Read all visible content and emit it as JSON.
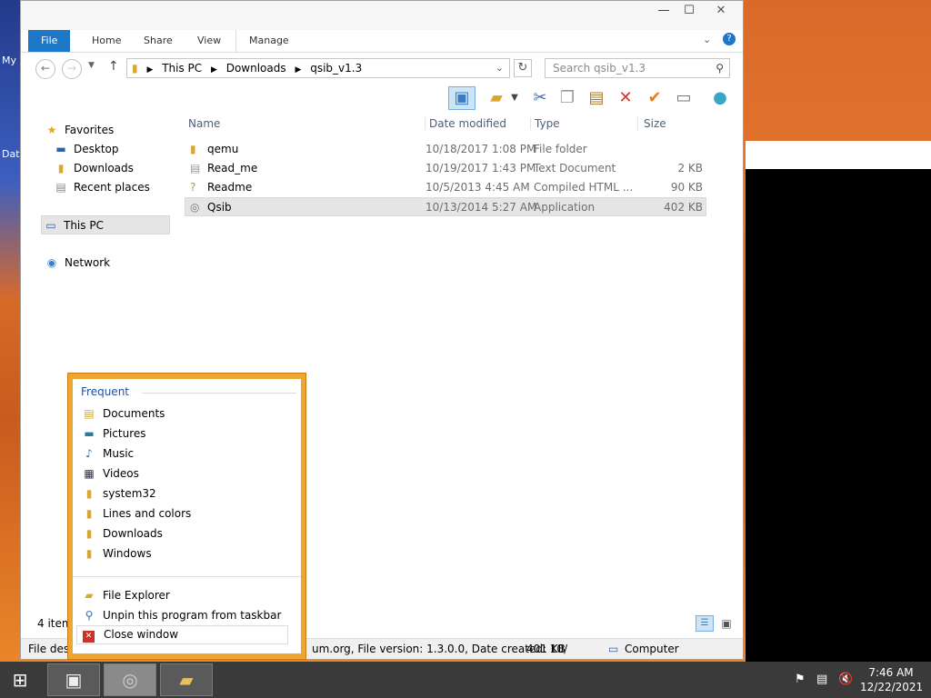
{
  "desktop": {
    "icon1_label": "My",
    "icon2_label": "Dat"
  },
  "window": {
    "ribbon_tabs": [
      "File",
      "Home",
      "Share",
      "View",
      "Manage"
    ],
    "address": {
      "crumbs": [
        "This PC",
        "Downloads",
        "qsib_v1.3"
      ]
    },
    "search_placeholder": "Search qsib_v1.3",
    "nav": {
      "favorites": "Favorites",
      "favorite_items": [
        "Desktop",
        "Downloads",
        "Recent places"
      ],
      "this_pc": "This PC",
      "network": "Network"
    },
    "columns": [
      "Name",
      "Date modified",
      "Type",
      "Size"
    ],
    "files": [
      {
        "name": "qemu",
        "date": "10/18/2017 1:08 PM",
        "type": "File folder",
        "size": ""
      },
      {
        "name": "Read_me",
        "date": "10/19/2017 1:43 PM",
        "type": "Text Document",
        "size": "2 KB"
      },
      {
        "name": "Readme",
        "date": "10/5/2013 4:45 AM",
        "type": "Compiled HTML ...",
        "size": "90 KB"
      },
      {
        "name": "Qsib",
        "date": "10/13/2014 5:27 AM",
        "type": "Application",
        "size": "402 KB"
      }
    ],
    "status": {
      "items": "4 item",
      "desc_prefix": "File desc",
      "desc_rest": "um.org, File version: 1.3.0.0, Date created: 10/",
      "size": "401 KB",
      "location": "Computer"
    }
  },
  "jumplist": {
    "header": "Frequent",
    "frequent": [
      "Documents",
      "Pictures",
      "Music",
      "Videos",
      "system32",
      "Lines and colors",
      "Downloads",
      "Windows"
    ],
    "tasks": [
      "File Explorer",
      "Unpin this program from taskbar",
      "Close window"
    ]
  },
  "clock": {
    "time": "7:46 AM",
    "date": "12/22/2021"
  }
}
